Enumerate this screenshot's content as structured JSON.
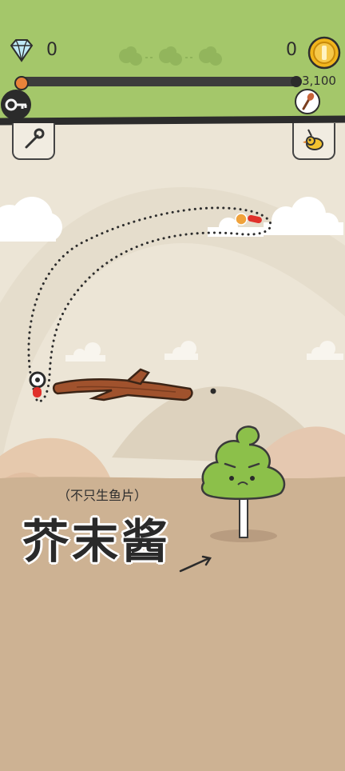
{
  "hud": {
    "gems": "0",
    "coins": "0",
    "score": "3,100",
    "progress_fraction": 0.0,
    "stage_icons": [
      "cloud-icon",
      "cloud-icon",
      "cloud-icon"
    ]
  },
  "tools": {
    "left": "wrench-icon",
    "right": "bird-icon",
    "key": "key-icon",
    "goal": "brush-icon"
  },
  "text": {
    "subtitle": "（不只生鱼片）",
    "title": "芥末酱"
  },
  "colors": {
    "top_bar": "#a4c76a",
    "sky": "#ece5d6",
    "ground": "#cdb293",
    "wasabi": "#8cc04a",
    "branch": "#a0522d",
    "accent_red": "#e0312b",
    "coin": "#f1b51c"
  }
}
